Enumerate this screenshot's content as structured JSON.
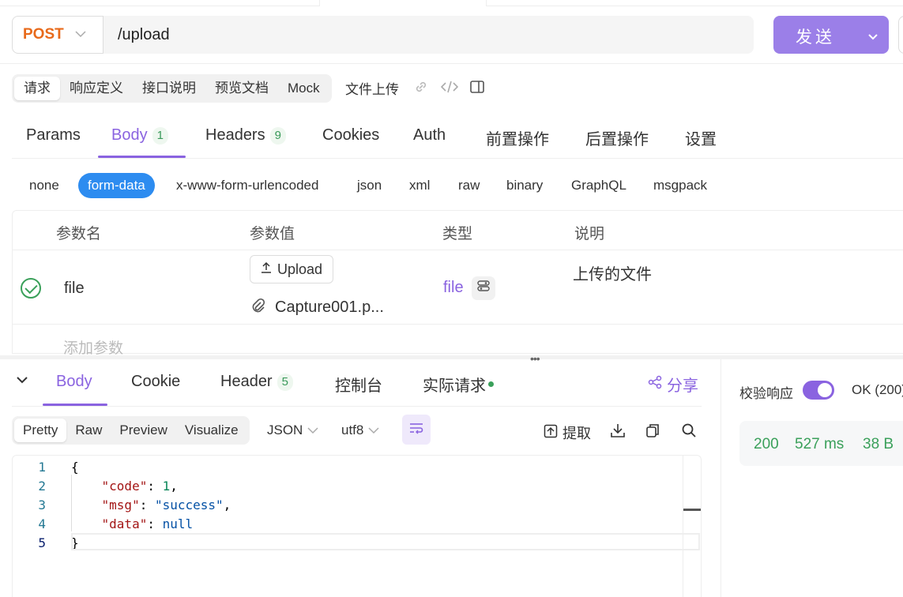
{
  "request": {
    "method": "POST",
    "url": "/upload",
    "send_label": "发送"
  },
  "view_tabs": [
    "请求",
    "响应定义",
    "接口说明",
    "预览文档",
    "Mock"
  ],
  "api_name": "文件上传",
  "request_tabs": {
    "params": "Params",
    "body": "Body",
    "body_count": "1",
    "headers": "Headers",
    "headers_count": "9",
    "cookies": "Cookies",
    "auth": "Auth",
    "pre": "前置操作",
    "post": "后置操作",
    "settings": "设置"
  },
  "body_types": [
    "none",
    "form-data",
    "x-www-form-urlencoded",
    "json",
    "xml",
    "raw",
    "binary",
    "GraphQL",
    "msgpack"
  ],
  "params_table": {
    "headers": [
      "参数名",
      "参数值",
      "类型",
      "说明"
    ],
    "row": {
      "name": "file",
      "upload_label": "Upload",
      "file_name": "Capture001.p...",
      "type": "file",
      "description": "上传的文件"
    },
    "add_placeholder": "添加参数"
  },
  "response_tabs": {
    "body": "Body",
    "cookie": "Cookie",
    "header": "Header",
    "header_count": "5",
    "console": "控制台",
    "actual": "实际请求",
    "share": "分享"
  },
  "format_tabs": [
    "Pretty",
    "Raw",
    "Preview",
    "Visualize"
  ],
  "format_type": "JSON",
  "encoding": "utf8",
  "tools": {
    "extract": "提取"
  },
  "code_lines": [
    "1",
    "2",
    "3",
    "4",
    "5"
  ],
  "code": {
    "open": "{",
    "k1": "\"code\"",
    "v1": "1",
    "k2": "\"msg\"",
    "v2": "\"success\"",
    "k3": "\"data\"",
    "v3": "null",
    "close": "}"
  },
  "right_panel": {
    "verify_label": "校验响应",
    "ok_text": "OK (200)",
    "status": "200",
    "time": "527 ms",
    "size": "38 B"
  },
  "colors": {
    "accent": "#8a63e0",
    "method": "#e86a1b",
    "active_body_type": "#2d8cf0",
    "success": "#3aa05a"
  }
}
